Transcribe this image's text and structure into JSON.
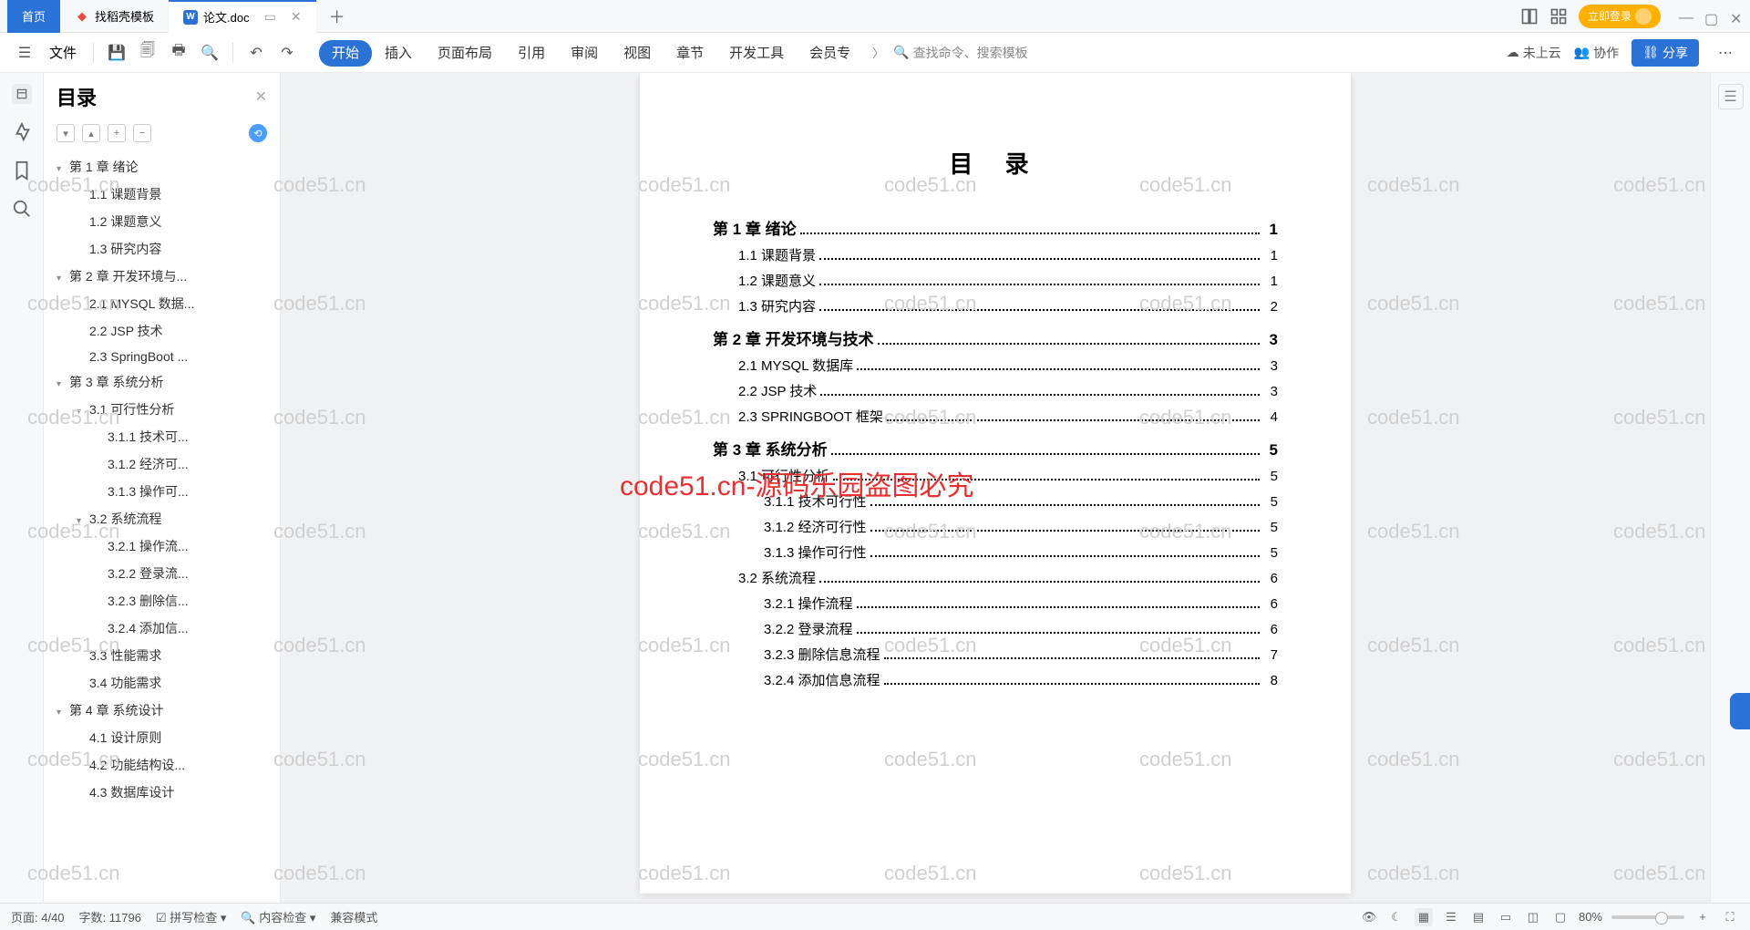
{
  "titlebar": {
    "home": "首页",
    "tabs": [
      {
        "label": "找稻壳模板",
        "icon": "fire-icon",
        "color": "#e74c3c"
      },
      {
        "label": "论文.doc",
        "icon": "word-icon",
        "color": "#2a72d6",
        "active": true
      }
    ],
    "login": "立即登录"
  },
  "menubar": {
    "file": "文件",
    "tabs": [
      "开始",
      "插入",
      "页面布局",
      "引用",
      "审阅",
      "视图",
      "章节",
      "开发工具",
      "会员专"
    ],
    "active_tab": 0,
    "search_placeholder": "查找命令、搜索模板",
    "cloud": "未上云",
    "collab": "协作",
    "share": "分享"
  },
  "outline": {
    "title": "目录",
    "items": [
      {
        "lv": 0,
        "chev": "▾",
        "label": "第 1 章  绪论"
      },
      {
        "lv": 1,
        "label": "1.1  课题背景"
      },
      {
        "lv": 1,
        "label": "1.2  课题意义"
      },
      {
        "lv": 1,
        "label": "1.3  研究内容"
      },
      {
        "lv": 0,
        "chev": "▾",
        "label": "第 2 章  开发环境与..."
      },
      {
        "lv": 1,
        "label": "2.1 MYSQL 数据..."
      },
      {
        "lv": 1,
        "label": "2.2 JSP 技术"
      },
      {
        "lv": 1,
        "label": "2.3 SpringBoot ..."
      },
      {
        "lv": 0,
        "chev": "▾",
        "label": "第 3 章  系统分析"
      },
      {
        "lv": 1,
        "chev": "▾",
        "label": "3.1  可行性分析"
      },
      {
        "lv": 2,
        "label": "3.1.1  技术可..."
      },
      {
        "lv": 2,
        "label": "3.1.2  经济可..."
      },
      {
        "lv": 2,
        "label": "3.1.3  操作可..."
      },
      {
        "lv": 1,
        "chev": "▾",
        "label": "3.2  系统流程"
      },
      {
        "lv": 2,
        "label": "3.2.1  操作流..."
      },
      {
        "lv": 2,
        "label": "3.2.2  登录流..."
      },
      {
        "lv": 2,
        "label": "3.2.3  删除信..."
      },
      {
        "lv": 2,
        "label": "3.2.4  添加信..."
      },
      {
        "lv": 1,
        "label": "3.3  性能需求"
      },
      {
        "lv": 1,
        "label": "3.4  功能需求"
      },
      {
        "lv": 0,
        "chev": "▾",
        "label": "第 4 章  系统设计"
      },
      {
        "lv": 1,
        "label": "4.1  设计原则"
      },
      {
        "lv": 1,
        "label": "4.2  功能结构设..."
      },
      {
        "lv": 1,
        "label": "4.3  数据库设计"
      }
    ]
  },
  "document": {
    "title": "目 录",
    "toc": [
      {
        "lv": 1,
        "label": "第 1 章  绪论",
        "page": "1"
      },
      {
        "lv": 2,
        "label": "1.1 课题背景",
        "page": "1"
      },
      {
        "lv": 2,
        "label": "1.2 课题意义",
        "page": "1"
      },
      {
        "lv": 2,
        "label": "1.3 研究内容",
        "page": "2"
      },
      {
        "lv": 1,
        "label": "第 2 章  开发环境与技术",
        "page": "3"
      },
      {
        "lv": 2,
        "label": "2.1 MYSQL 数据库",
        "page": "3",
        "sc": true
      },
      {
        "lv": 2,
        "label": "2.2 JSP 技术",
        "page": "3",
        "sc": true
      },
      {
        "lv": 2,
        "label": "2.3 SPRINGBOOT 框架",
        "page": "4",
        "sc": true
      },
      {
        "lv": 1,
        "label": "第 3 章  系统分析",
        "page": "5"
      },
      {
        "lv": 2,
        "label": "3.1 可行性分析",
        "page": "5"
      },
      {
        "lv": 3,
        "label": "3.1.1  技术可行性",
        "page": "5"
      },
      {
        "lv": 3,
        "label": "3.1.2  经济可行性",
        "page": "5"
      },
      {
        "lv": 3,
        "label": "3.1.3  操作可行性",
        "page": "5"
      },
      {
        "lv": 2,
        "label": "3.2 系统流程",
        "page": "6"
      },
      {
        "lv": 3,
        "label": "3.2.1  操作流程",
        "page": "6"
      },
      {
        "lv": 3,
        "label": "3.2.2  登录流程",
        "page": "6"
      },
      {
        "lv": 3,
        "label": "3.2.3  删除信息流程",
        "page": "7"
      },
      {
        "lv": 3,
        "label": "3.2.4  添加信息流程",
        "page": "8"
      }
    ]
  },
  "statusbar": {
    "page": "页面: 4/40",
    "words": "字数: 11796",
    "spell": "拼写检查",
    "content": "内容检查",
    "compat": "兼容模式",
    "zoom": "80%"
  },
  "watermark": {
    "text": "code51.cn",
    "red": "code51.cn-源码乐园盗图必究"
  }
}
